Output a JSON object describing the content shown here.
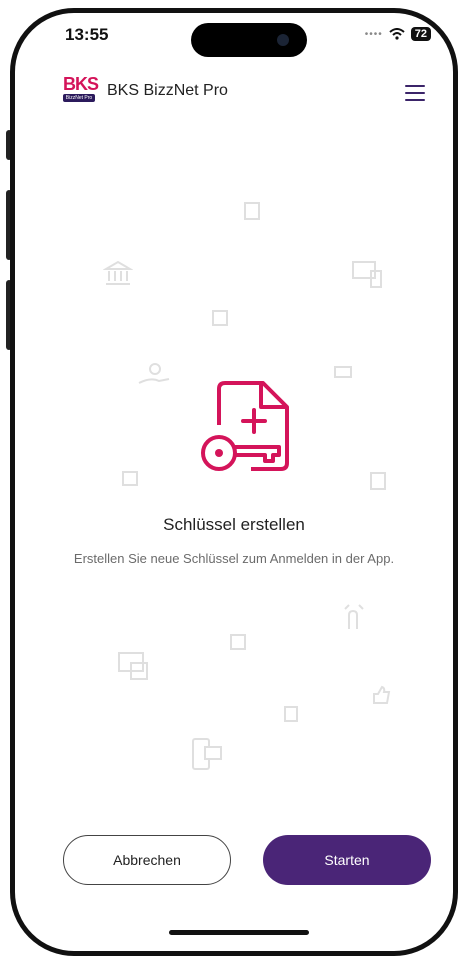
{
  "status_bar": {
    "time": "13:55",
    "battery": "72"
  },
  "header": {
    "logo_text": "BKS",
    "logo_sub": "BizzNet Pro",
    "title": "BKS BizzNet Pro",
    "menu_icon": "hamburger-menu-icon"
  },
  "hero": {
    "icon": "document-key-add-icon",
    "title": "Schlüssel erstellen",
    "description": "Erstellen Sie neue Schlüssel zum Anmelden in der App."
  },
  "actions": {
    "cancel_label": "Abbrechen",
    "start_label": "Starten"
  },
  "colors": {
    "brand_pink": "#d4145a",
    "brand_purple": "#4a2577",
    "logo_navy": "#2b1a5c"
  }
}
